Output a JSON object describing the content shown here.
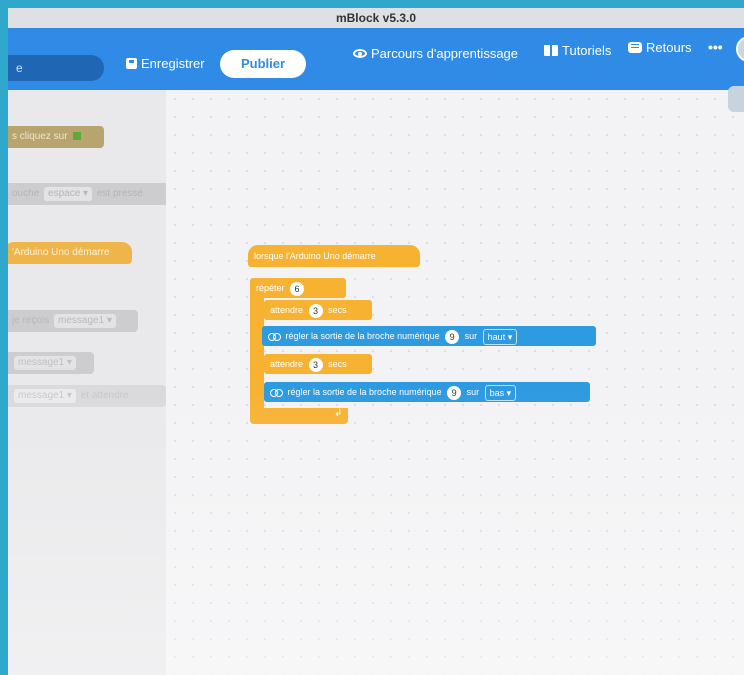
{
  "window": {
    "title": "mBlock v5.3.0"
  },
  "toolbar": {
    "search_text": "e",
    "save_label": "Enregistrer",
    "publish_label": "Publier",
    "learning_label": "Parcours d'apprentissage",
    "tutorials_label": "Tutoriels",
    "feedback_label": "Retours",
    "more_label": "•••"
  },
  "palette": {
    "block1": "s cliquez sur",
    "block2_prefix": "ouche",
    "block2_key": "espace ▾",
    "block2_suffix": "est pressé",
    "block3": "'Arduino Uno démarre",
    "block4_prefix": "je reçois",
    "block4_msg": "message1 ▾",
    "block5_msg": "message1 ▾",
    "block6_msg": "message1 ▾",
    "block6_suffix": "et attendre"
  },
  "script": {
    "hat_label": "lorsque l'Arduino Uno démarre",
    "repeat_label": "répéter",
    "repeat_count": "6",
    "wait1_label": "attendre",
    "wait1_value": "3",
    "wait1_unit": "secs",
    "set1_label": "régler la sortie de la broche numérique",
    "set1_pin": "9",
    "set1_sur": "sur",
    "set1_state": "haut ▾",
    "wait2_label": "attendre",
    "wait2_value": "3",
    "wait2_unit": "secs",
    "set2_label": "régler la sortie de la broche numérique",
    "set2_pin": "9",
    "set2_sur": "sur",
    "set2_state": "bas ▾",
    "loop_arrow": "↲"
  },
  "colors": {
    "topbar": "#2f8be6",
    "event_block": "#f7b232",
    "arduino_block": "#2e9ae0",
    "desktop_border": "#2fa8cc"
  }
}
